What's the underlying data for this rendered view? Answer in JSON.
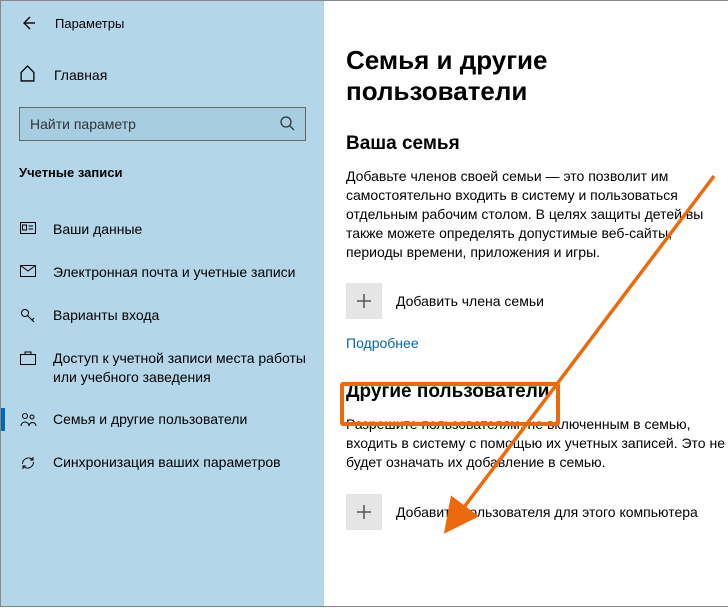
{
  "window": {
    "title": "Параметры"
  },
  "sidebar": {
    "home": "Главная",
    "search_placeholder": "Найти параметр",
    "category": "Учетные записи",
    "items": [
      {
        "label": "Ваши данные"
      },
      {
        "label": "Электронная почта и учетные записи"
      },
      {
        "label": "Варианты входа"
      },
      {
        "label": "Доступ к учетной записи места работы или учебного заведения"
      },
      {
        "label": "Семья и другие пользователи"
      },
      {
        "label": "Синхронизация ваших параметров"
      }
    ]
  },
  "main": {
    "heading": "Семья и другие пользователи",
    "family": {
      "title": "Ваша семья",
      "desc": "Добавьте членов своей семьи — это позволит им самостоятельно входить в систему и пользоваться отдельным рабочим столом. В целях защиты детей вы также можете определять допустимые веб-сайты, периоды времени, приложения и игры.",
      "add_label": "Добавить члена семьи",
      "more": "Подробнее"
    },
    "others": {
      "title": "Другие пользователи",
      "desc": "Разрешите пользователям, не включенным в семью, входить в систему с помощью их учетных записей. Это не будет означать их добавление в семью.",
      "add_label": "Добавить пользователя для этого компьютера"
    }
  }
}
